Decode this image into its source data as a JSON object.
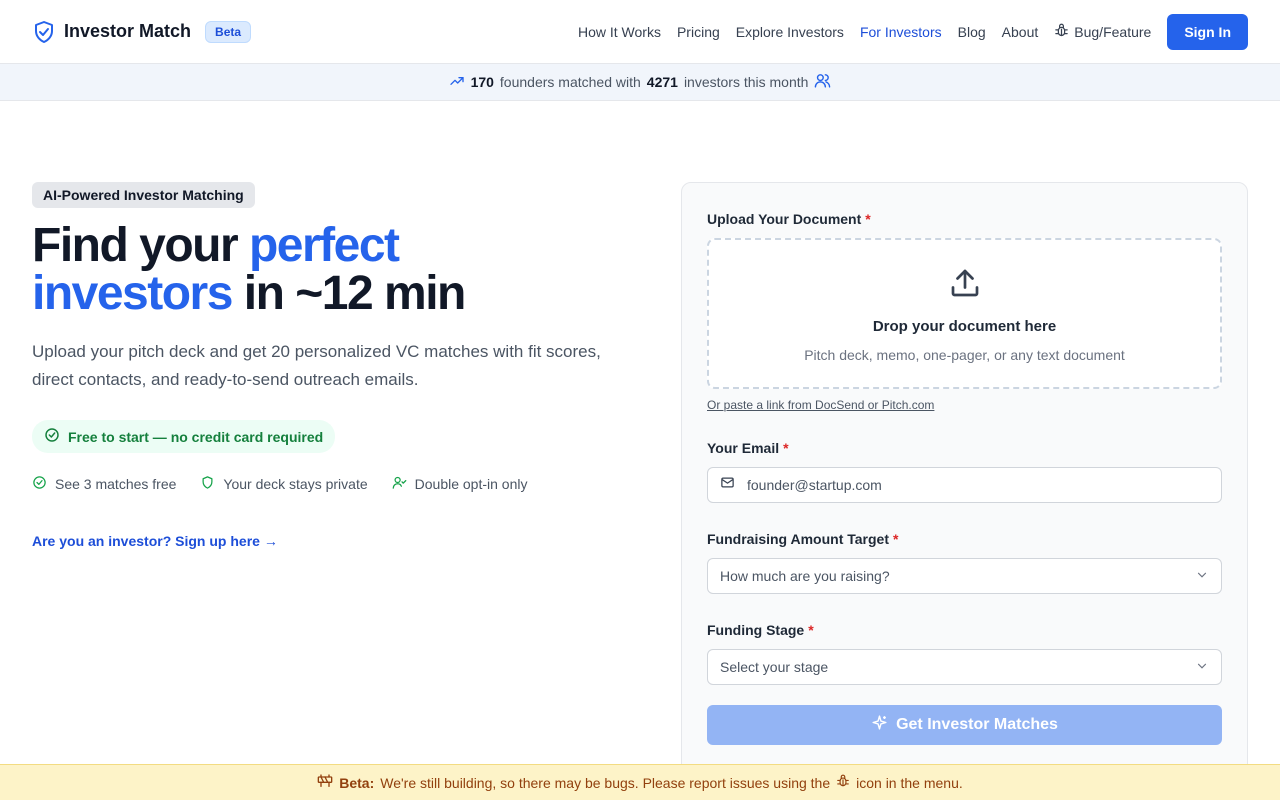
{
  "header": {
    "brand_name": "Investor Match",
    "beta_label": "Beta",
    "nav": [
      {
        "label": "How It Works"
      },
      {
        "label": "Pricing"
      },
      {
        "label": "Explore Investors"
      },
      {
        "label": "For Investors"
      },
      {
        "label": "Blog"
      },
      {
        "label": "About"
      },
      {
        "label": "Bug/Feature"
      }
    ],
    "signin_label": "Sign In"
  },
  "stats": {
    "founders_count": "170",
    "founders_text": "founders matched with",
    "investors_count": "4271",
    "investors_text": "investors this month"
  },
  "hero": {
    "chip": "AI-Powered Investor Matching",
    "headline_1": "Find your ",
    "headline_2": "perfect",
    "headline_3": "investors",
    "headline_4": " in ~12 min",
    "subtitle": "Upload your pitch deck and get 20 personalized VC matches with fit scores, direct contacts, and ready-to-send outreach emails.",
    "free_pill": "Free to start — no credit card required",
    "features": [
      {
        "label": "See 3 matches free"
      },
      {
        "label": "Your deck stays private"
      },
      {
        "label": "Double opt-in only"
      }
    ],
    "investor_link": "Are you an investor? Sign up here →"
  },
  "form": {
    "upload_label": "Upload Your Document",
    "required_mark": "*",
    "dropzone_title": "Drop your document here",
    "dropzone_sub": "Pitch deck, memo, one-pager, or any text document",
    "paste_link": "Or paste a link from DocSend or Pitch.com",
    "email_label": "Your Email",
    "email_placeholder": "founder@startup.com",
    "amount_label": "Fundraising Amount Target",
    "amount_placeholder": "How much are you raising?",
    "stage_label": "Funding Stage",
    "stage_placeholder": "Select your stage",
    "submit_label": "Get Investor Matches"
  },
  "banner": {
    "bold": "Beta:",
    "text_1": "We're still building, so there may be bugs. Please report issues using the",
    "text_2": "icon in the menu."
  },
  "colors": {
    "accent": "#2563eb",
    "success": "#15803d",
    "banner_bg": "#fdf3c8",
    "required": "#dc2626"
  }
}
